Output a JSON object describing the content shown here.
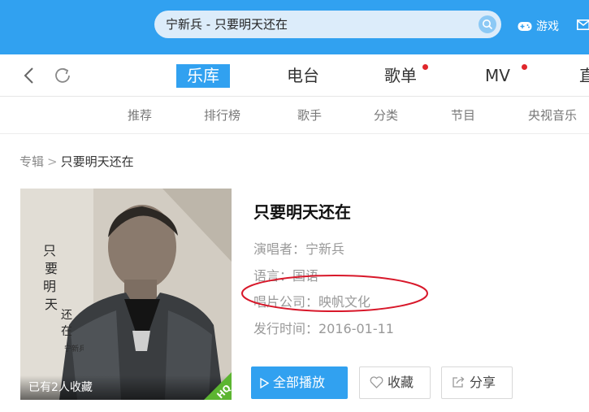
{
  "search": {
    "query": "宁新兵 - 只要明天还在"
  },
  "header": {
    "games_label": "游戏"
  },
  "tabs": [
    {
      "label": "乐库",
      "active": true,
      "badge": false
    },
    {
      "label": "电台",
      "active": false,
      "badge": false
    },
    {
      "label": "歌单",
      "active": false,
      "badge": true
    },
    {
      "label": "MV",
      "active": false,
      "badge": true
    },
    {
      "label": "直",
      "active": false,
      "badge": false
    }
  ],
  "subnav": [
    "推荐",
    "排行榜",
    "歌手",
    "分类",
    "节目",
    "央视音乐"
  ],
  "breadcrumb": {
    "parent": "专辑",
    "separator": ">",
    "current": "只要明天还在"
  },
  "album": {
    "title": "只要明天还在",
    "singer": "演唱者：宁新兵",
    "language": "语言：国语",
    "label": "唱片公司：映帆文化",
    "release": "发行时间：2016-01-11",
    "collected": "已有2人收藏",
    "quality_badge": "HQ",
    "cover_text": [
      "只",
      "要",
      "明",
      "天",
      "还",
      "在",
      "宁新兵"
    ]
  },
  "buttons": {
    "play_all": "全部播放",
    "favorite": "收藏",
    "share": "分享"
  },
  "colors": {
    "accent": "#31a1f0",
    "badge_dot": "#e0262b",
    "hq_green": "#5cb531",
    "annotation": "#d8182a"
  }
}
